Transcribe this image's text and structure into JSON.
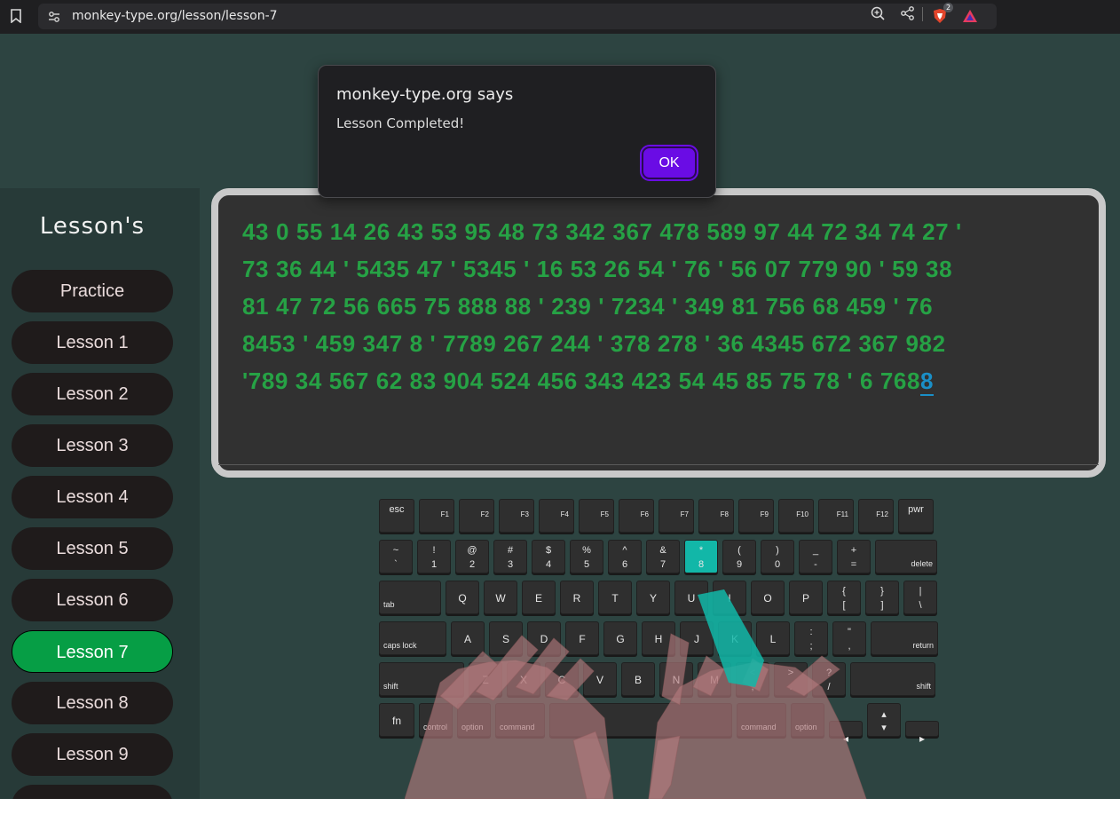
{
  "browser": {
    "url": "monkey-type.org/lesson/lesson-7",
    "shields_badge": "2",
    "icons": [
      "bookmark-icon",
      "site-info-icon",
      "zoom-icon",
      "share-icon",
      "brave-shields-icon",
      "brave-rewards-icon"
    ]
  },
  "dialog": {
    "title": "monkey-type.org says",
    "message": "Lesson Completed!",
    "ok_label": "OK",
    "ok_color": "#6a0ce5"
  },
  "sidebar": {
    "title": "Lesson's",
    "items": [
      {
        "label": "Practice",
        "active": false
      },
      {
        "label": "Lesson 1",
        "active": false
      },
      {
        "label": "Lesson 2",
        "active": false
      },
      {
        "label": "Lesson 3",
        "active": false
      },
      {
        "label": "Lesson 4",
        "active": false
      },
      {
        "label": "Lesson 5",
        "active": false
      },
      {
        "label": "Lesson 6",
        "active": false
      },
      {
        "label": "Lesson 7",
        "active": true
      },
      {
        "label": "Lesson 8",
        "active": false
      },
      {
        "label": "Lesson 9",
        "active": false
      }
    ],
    "active_color": "#069e45"
  },
  "typing": {
    "lines": [
      "43 0 55 14 26 43 53 95 48 73 342 367 478 589 97 44 72 34 74 27 '",
      "73 36 44 ' 5435 47 ' 5345 ' 16 53 26 54 ' 76 ' 56 07 779 90 ' 59 38",
      "81 47 72 56 665 75 888 88 ' 239 ' 7234 ' 349 81 756 68 459 ' 76",
      "8453 ' 459 347 8 ' 7789 267 244 ' 378 278 ' 36 4345 672 367 982",
      "'789 34 567 62 83 904 524 456 343 423 54 45 85 75 78 ' 6 768"
    ],
    "cursor_char": "8",
    "typed_color": "#26a245",
    "cursor_color": "#1a8fc7"
  },
  "keyboard": {
    "row_fn": [
      {
        "main": "esc"
      },
      {
        "main": "F1"
      },
      {
        "main": "F2"
      },
      {
        "main": "F3"
      },
      {
        "main": "F4"
      },
      {
        "main": "F5"
      },
      {
        "main": "F6"
      },
      {
        "main": "F7"
      },
      {
        "main": "F8"
      },
      {
        "main": "F9"
      },
      {
        "main": "F10"
      },
      {
        "main": "F11"
      },
      {
        "main": "F12"
      },
      {
        "main": "pwr"
      }
    ],
    "row_num": [
      {
        "top": "~",
        "bot": "`"
      },
      {
        "top": "!",
        "bot": "1"
      },
      {
        "top": "@",
        "bot": "2"
      },
      {
        "top": "#",
        "bot": "3"
      },
      {
        "top": "$",
        "bot": "4"
      },
      {
        "top": "%",
        "bot": "5"
      },
      {
        "top": "^",
        "bot": "6"
      },
      {
        "top": "&",
        "bot": "7"
      },
      {
        "top": "*",
        "bot": "8",
        "highlight": true
      },
      {
        "top": "(",
        "bot": "9"
      },
      {
        "top": ")",
        "bot": "0"
      },
      {
        "top": "_",
        "bot": "-"
      },
      {
        "top": "+",
        "bot": "="
      },
      {
        "main": "delete"
      }
    ],
    "row_q": [
      {
        "main": "tab"
      },
      {
        "main": "Q"
      },
      {
        "main": "W"
      },
      {
        "main": "E"
      },
      {
        "main": "R"
      },
      {
        "main": "T"
      },
      {
        "main": "Y"
      },
      {
        "main": "U"
      },
      {
        "main": "I"
      },
      {
        "main": "O"
      },
      {
        "main": "P"
      },
      {
        "top": "{",
        "bot": "["
      },
      {
        "top": "}",
        "bot": "]"
      },
      {
        "top": "|",
        "bot": "\\"
      }
    ],
    "row_a": [
      {
        "main": "caps lock"
      },
      {
        "main": "A"
      },
      {
        "main": "S"
      },
      {
        "main": "D"
      },
      {
        "main": "F"
      },
      {
        "main": "G"
      },
      {
        "main": "H"
      },
      {
        "main": "J"
      },
      {
        "main": "K"
      },
      {
        "main": "L"
      },
      {
        "top": ":",
        "bot": ";"
      },
      {
        "top": "\"",
        "bot": ","
      },
      {
        "main": "return"
      }
    ],
    "row_z": [
      {
        "main": "shift"
      },
      {
        "main": "Z"
      },
      {
        "main": "X"
      },
      {
        "main": "C"
      },
      {
        "main": "V"
      },
      {
        "main": "B"
      },
      {
        "main": "N"
      },
      {
        "main": "M"
      },
      {
        "top": "<",
        "bot": ","
      },
      {
        "top": ">",
        "bot": "."
      },
      {
        "top": "?",
        "bot": "/"
      },
      {
        "main": "shift"
      }
    ],
    "row_bottom": [
      {
        "main": "fn"
      },
      {
        "main": "control"
      },
      {
        "main": "option"
      },
      {
        "main": "command"
      },
      {
        "main": ""
      },
      {
        "main": "command"
      },
      {
        "main": "option"
      },
      {
        "main": "◂"
      },
      {
        "top": "▴",
        "bot": "▾"
      },
      {
        "main": "▸"
      }
    ],
    "highlight_color": "#12b7a8"
  }
}
